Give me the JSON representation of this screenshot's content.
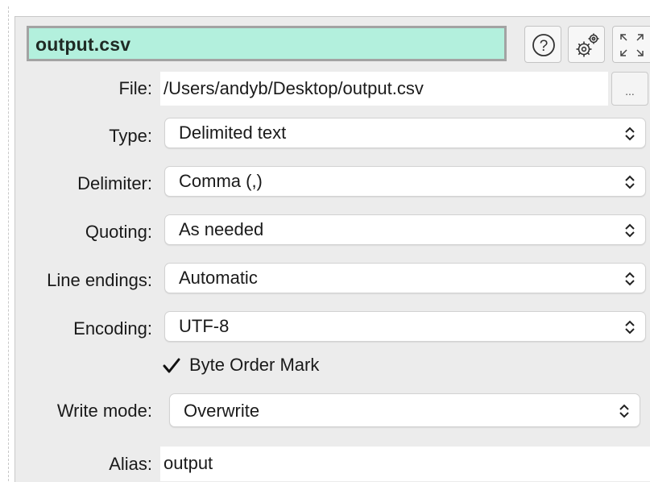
{
  "header": {
    "title": "output.csv",
    "help_icon": "help-circle-icon",
    "settings_icon": "gears-icon",
    "expand_icon": "expand-arrows-icon"
  },
  "form": {
    "file": {
      "label": "File:",
      "value": "/Users/andyb/Desktop/output.csv",
      "browse_label": "..."
    },
    "type": {
      "label": "Type:",
      "value": "Delimited text"
    },
    "delimiter": {
      "label": "Delimiter:",
      "value": "Comma (,)"
    },
    "quoting": {
      "label": "Quoting:",
      "value": "As needed"
    },
    "line_endings": {
      "label": "Line endings:",
      "value": "Automatic"
    },
    "encoding": {
      "label": "Encoding:",
      "value": "UTF-8"
    },
    "bom": {
      "label": "Byte Order Mark",
      "checked": true
    },
    "write_mode": {
      "label": "Write mode:",
      "value": "Overwrite"
    },
    "alias": {
      "label": "Alias:",
      "value": "output"
    }
  },
  "colors": {
    "title_bg": "#b3f0dd",
    "panel_bg": "#ececec"
  }
}
